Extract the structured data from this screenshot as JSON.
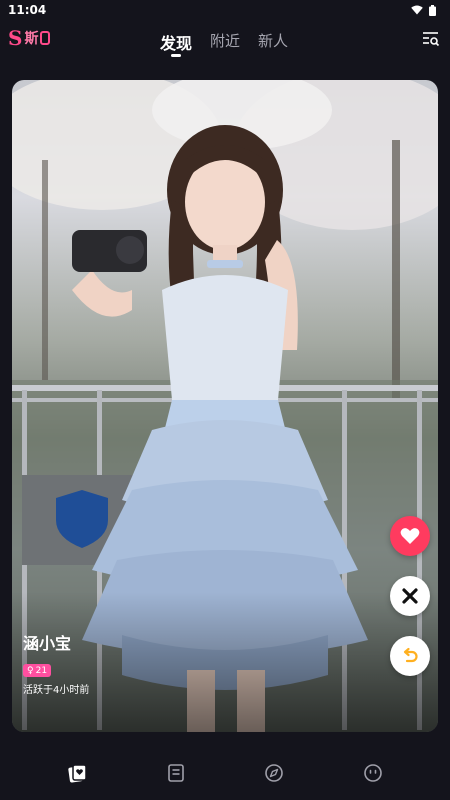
{
  "status_bar": {
    "time": "11:04"
  },
  "app": {
    "logo_letter": "S",
    "logo_text": "斯"
  },
  "tabs": [
    {
      "label": "发现",
      "active": true
    },
    {
      "label": "附近",
      "active": false
    },
    {
      "label": "新人",
      "active": false
    }
  ],
  "profile": {
    "name": "涵小宝",
    "gender_symbol": "♀",
    "age": "21",
    "active_status": "活跃于4小时前"
  },
  "actions": {
    "like_icon": "heart-icon",
    "dislike_icon": "close-icon",
    "undo_icon": "undo-icon"
  },
  "bottom_nav": [
    {
      "icon": "card-stack-icon",
      "active": true
    },
    {
      "icon": "document-icon",
      "active": false
    },
    {
      "icon": "compass-icon",
      "active": false
    },
    {
      "icon": "smiley-icon",
      "active": false
    }
  ],
  "colors": {
    "background": "#14141c",
    "accent": "#ff4a8a",
    "like": "#ff3b5f",
    "undo": "#ffb020",
    "badge": "#ff4fa0"
  }
}
